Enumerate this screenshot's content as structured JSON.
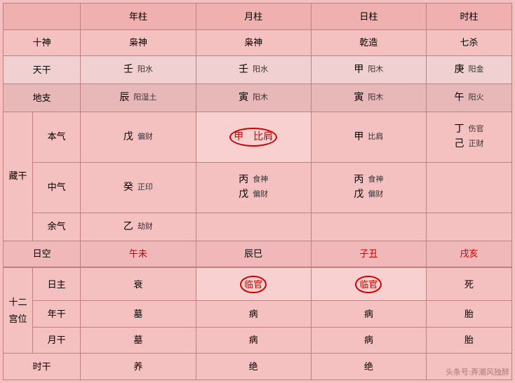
{
  "table": {
    "headers": {
      "col1": "",
      "col2": "年柱",
      "col3": "月柱",
      "col4": "日柱",
      "col5": "时柱"
    },
    "shi_shen_row": {
      "label": "十神",
      "col2": "枭神",
      "col3": "枭神",
      "col4": "乾造",
      "col5": "七杀"
    },
    "tian_gan_row": {
      "label": "天干",
      "col2_main": "壬",
      "col2_sub": "阳水",
      "col3_main": "壬",
      "col3_sub": "阳水",
      "col4_main": "甲",
      "col4_sub": "阳木",
      "col5_main": "庚",
      "col5_sub": "阳金"
    },
    "di_zhi_row": {
      "label": "地支",
      "col2_main": "辰",
      "col2_sub": "阳湿土",
      "col3_main": "寅",
      "col3_sub": "阳木",
      "col4_main": "寅",
      "col4_sub": "阳木",
      "col5_main": "午",
      "col5_sub": "阳火"
    },
    "ben_qi_row": {
      "label1": "藏干",
      "label2": "本气",
      "col2_main": "戊",
      "col2_sub": "偏财",
      "col3_main": "甲",
      "col3_sub": "比肩",
      "col3_circled": true,
      "col4_main": "甲",
      "col4_sub": "比肩",
      "col5_line1": "丁",
      "col5_sub1": "伤官",
      "col5_line2": "己",
      "col5_sub2": "正财"
    },
    "zhong_qi_row": {
      "label": "中气",
      "col2_main": "癸",
      "col2_sub": "正印",
      "col3_line1": "丙",
      "col3_sub1": "食神",
      "col3_line2": "戊",
      "col3_sub2": "偏财",
      "col4_line1": "丙",
      "col4_sub1": "食神",
      "col4_line2": "戊",
      "col4_sub2": "偏财",
      "col5": ""
    },
    "yu_qi_row": {
      "label": "余气",
      "col2_main": "乙",
      "col2_sub": "劫财",
      "col3": "",
      "col4": "",
      "col5": ""
    },
    "ri_kong_row": {
      "label": "日空",
      "col2": "午未",
      "col3": "辰巳",
      "col4": "子丑",
      "col5": "戌亥",
      "col2_red": true,
      "col4_red": true,
      "col5_red": true
    },
    "shi_er_header": {
      "label1": "十二",
      "label2": "宫位",
      "sublabel": "日主",
      "col2": "衰",
      "col3": "临官",
      "col3_circled": true,
      "col4": "临官",
      "col4_circled": true,
      "col5": "死"
    },
    "nian_gan_row": {
      "label": "年干",
      "col2": "墓",
      "col3": "病",
      "col4": "病",
      "col5": "胎"
    },
    "yue_gan_row": {
      "label": "月干",
      "col2": "墓",
      "col3": "病",
      "col4": "病",
      "col5": "胎"
    },
    "shi_gan_row": {
      "label": "时干",
      "col2": "养",
      "col3": "绝",
      "col4": "绝",
      "col5": ""
    }
  },
  "watermark": "头条号:弄潮风独醉"
}
